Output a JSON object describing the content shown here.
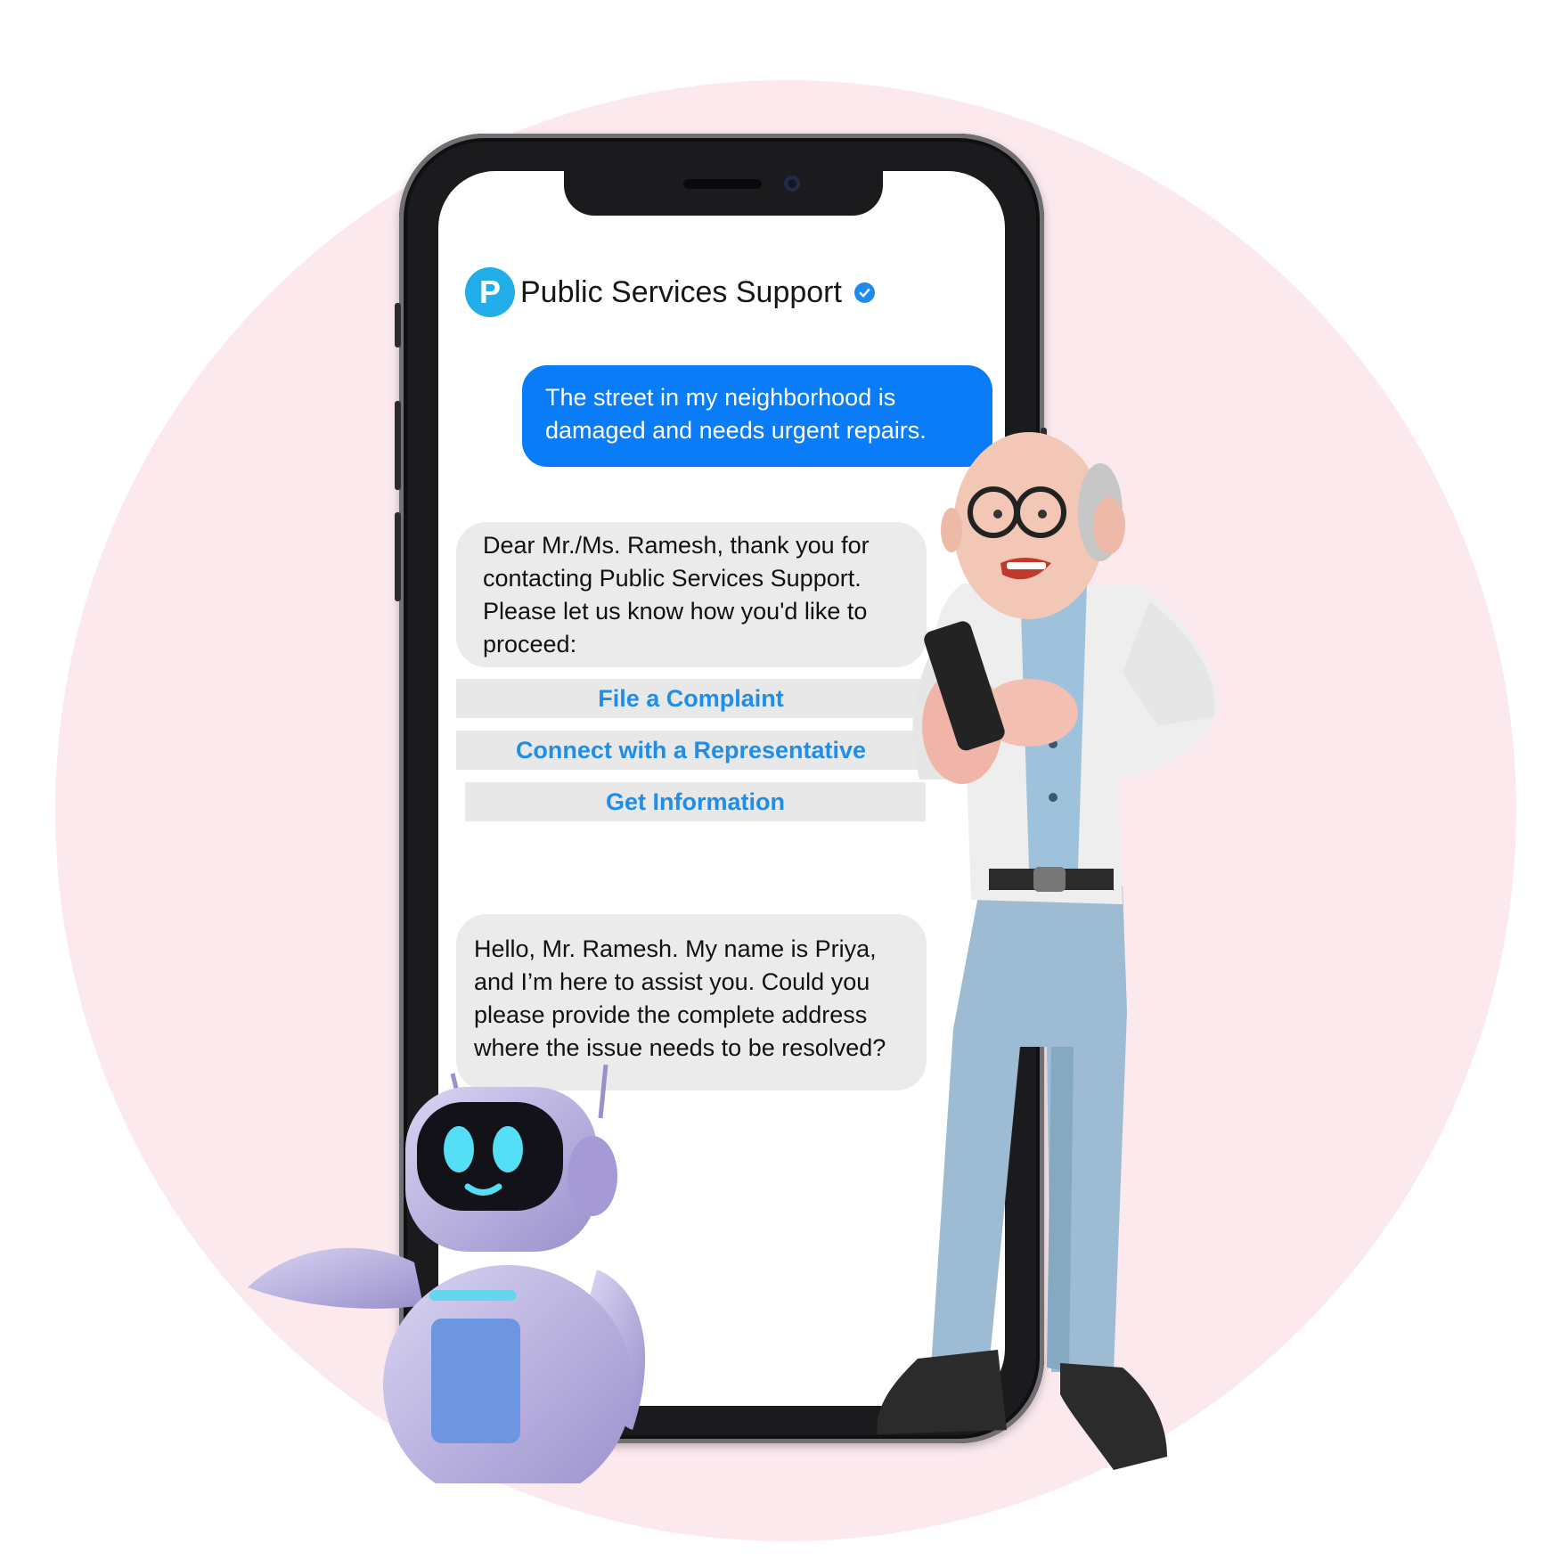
{
  "header": {
    "logo_letter": "P",
    "title": "Public Services Support",
    "verified_icon": "verified-check-icon",
    "accent_color": "#22aee8"
  },
  "messages": [
    {
      "sender": "user",
      "text": "The street in my neighborhood is damaged and needs urgent repairs."
    },
    {
      "sender": "bot",
      "text": "Dear Mr./Ms. Ramesh, thank you for contacting Public Services Support. Please let us know how you'd like to proceed:"
    },
    {
      "sender": "bot",
      "text": "Hello, Mr. Ramesh. My name is Priya, and I’m here to assist you. Could you please provide the complete address where the issue needs to be resolved?"
    }
  ],
  "quick_replies": [
    {
      "label": "File a Complaint"
    },
    {
      "label": "Connect with a Representative"
    },
    {
      "label": "Get Information"
    }
  ],
  "colors": {
    "user_bubble": "#0b7cf7",
    "bot_bubble": "#ebebeb",
    "quick_reply_text": "#1e8ee9",
    "background_circle": "#fbe9ee"
  }
}
